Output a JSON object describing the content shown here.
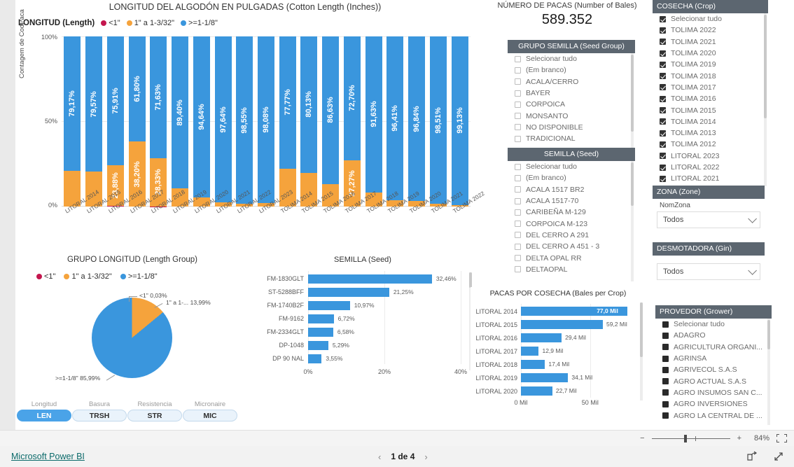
{
  "stacked_chart": {
    "title": "LONGITUD DEL ALGODÓN EN PULGADAS (Cotton Length (Inches))",
    "legend_title": "LONGITUD (Length)",
    "y_axis_label": "Contagem de CodPaca",
    "y_ticks": [
      "100%",
      "50%",
      "0%"
    ],
    "legend": [
      {
        "label": "<1\"",
        "color": "#c4164e"
      },
      {
        "label": "1\" a 1-3/32\"",
        "color": "#f5a33c"
      },
      {
        "label": ">=1-1/8\"",
        "color": "#3a96dd"
      }
    ]
  },
  "chart_data": [
    {
      "type": "bar",
      "title": "LONGITUD DEL ALGODÓN EN PULGADAS (Cotton Length (Inches))",
      "subtype": "stacked-100",
      "xlabel": "",
      "ylabel": "Contagem de CodPaca",
      "ylim": [
        0,
        100
      ],
      "categories": [
        "LITORAL 2014",
        "LITORAL 2015",
        "LITORAL 2016",
        "LITORAL 2017",
        "LITORAL 2018",
        "LITORAL 2019",
        "LITORAL 2020",
        "LITORAL 2021",
        "LITORAL 2022",
        "LITORAL 2023",
        "TOLIMA 2014",
        "TOLIMA 2015",
        "TOLIMA 2016",
        "TOLIMA 2017",
        "TOLIMA 2018",
        "TOLIMA 2019",
        "TOLIMA 2020",
        "TOLIMA 2021",
        "TOLIMA 2022"
      ],
      "series": [
        {
          "name": ">=1-1/8\"",
          "color": "#3a96dd",
          "values": [
            79.17,
            79.57,
            75.91,
            61.8,
            71.63,
            89.4,
            94.64,
            97.64,
            98.55,
            98.08,
            77.77,
            80.13,
            86.63,
            72.7,
            91.63,
            96.41,
            96.84,
            98.51,
            99.13
          ],
          "labels": [
            "79,17%",
            "79,57%",
            "75,91%",
            "61,80%",
            "71,63%",
            "89,40%",
            "94,64%",
            "97,64%",
            "98,55%",
            "98,08%",
            "77,77%",
            "80,13%",
            "86,63%",
            "72,70%",
            "91,63%",
            "96,41%",
            "96,84%",
            "98,51%",
            "99,13%"
          ]
        },
        {
          "name": "1\" a 1-3/32\"",
          "color": "#f5a33c",
          "values": [
            20.8,
            20.4,
            23.88,
            38.2,
            28.33,
            10.57,
            5.33,
            2.34,
            1.43,
            1.9,
            22.2,
            19.84,
            13.34,
            27.27,
            8.34,
            3.56,
            3.13,
            1.46,
            0.85
          ],
          "labels": [
            "",
            "",
            "23,88%",
            "38,20%",
            "28,33%",
            "",
            "",
            "",
            "",
            "",
            "",
            "",
            "",
            "27,27%",
            "",
            "",
            "",
            "",
            ""
          ]
        },
        {
          "name": "<1\"",
          "color": "#c4164e",
          "values": [
            0.03,
            0.03,
            0.21,
            0.0,
            0.04,
            0.03,
            0.03,
            0.02,
            0.02,
            0.02,
            0.03,
            0.03,
            0.03,
            0.03,
            0.03,
            0.03,
            0.03,
            0.03,
            0.02
          ],
          "labels": [
            "",
            "",
            "",
            "",
            "",
            "",
            "",
            "",
            "",
            "",
            "",
            "",
            "",
            "",
            "",
            "",
            "",
            "",
            ""
          ]
        }
      ],
      "legend_position": "top"
    },
    {
      "type": "pie",
      "title": "GRUPO LONGITUD (Length Group)",
      "labels": [
        "<1\"",
        "1\" a 1-...",
        ">=1-1/8\""
      ],
      "values": [
        0.03,
        13.99,
        85.99
      ],
      "value_labels": [
        "<1\" 0,03%",
        "1\" a 1-... 13,99%",
        ">=1-1/8\" 85,99%"
      ],
      "colors": [
        "#c4164e",
        "#f5a33c",
        "#3a96dd"
      ],
      "legend": [
        "<1\"",
        "1\" a 1-3/32\"",
        ">=1-1/8\""
      ],
      "legend_position": "top"
    },
    {
      "type": "bar",
      "subtype": "horizontal",
      "title": "SEMILLA (Seed)",
      "categories": [
        "FM-1830GLT",
        "ST-5288BFF",
        "FM-1740B2F",
        "FM-9162",
        "FM-2334GLT",
        "DP-1048",
        "DP 90 NAL"
      ],
      "values": [
        32.46,
        21.25,
        10.97,
        6.72,
        6.58,
        5.29,
        3.55
      ],
      "value_labels": [
        "32,46%",
        "21,25%",
        "10,97%",
        "6,72%",
        "6,58%",
        "5,29%",
        "3,55%"
      ],
      "x_ticks": [
        "0%",
        "20%",
        "40%"
      ],
      "xlim": [
        0,
        40
      ],
      "color": "#3a96dd"
    },
    {
      "type": "bar",
      "subtype": "horizontal",
      "title": "PACAS POR COSECHA (Bales per Crop)",
      "categories": [
        "LITORAL 2014",
        "LITORAL 2015",
        "LITORAL 2016",
        "LITORAL 2017",
        "LITORAL 2018",
        "LITORAL 2019",
        "LITORAL 2020"
      ],
      "values": [
        77.0,
        59.2,
        29.4,
        12.9,
        17.4,
        34.1,
        22.7
      ],
      "value_labels": [
        "77,0 Mil",
        "59,2 Mil",
        "29,4 Mil",
        "12,9 Mil",
        "17,4 Mil",
        "34,1 Mil",
        "22,7 Mil"
      ],
      "x_ticks": [
        "0 Mil",
        "50 Mil"
      ],
      "xlim": [
        0,
        85
      ],
      "color": "#3a96dd"
    }
  ],
  "kpi": {
    "title": "NÚMERO DE PACAS (Number of Bales)",
    "value": "589.352"
  },
  "slicer_seed_group": {
    "header": "GRUPO SEMILLA (Seed Group)",
    "items": [
      {
        "label": "Selecionar tudo",
        "checked": false
      },
      {
        "label": "(Em branco)",
        "checked": false
      },
      {
        "label": "ACALA/CERRO",
        "checked": false
      },
      {
        "label": "BAYER",
        "checked": false
      },
      {
        "label": "CORPOICA",
        "checked": false
      },
      {
        "label": "MONSANTO",
        "checked": false
      },
      {
        "label": "NO DISPONIBLE",
        "checked": false
      },
      {
        "label": "TRADICIONAL",
        "checked": false
      }
    ]
  },
  "slicer_seed": {
    "header": "SEMILLA (Seed)",
    "items": [
      {
        "label": "Selecionar tudo",
        "checked": false
      },
      {
        "label": "(Em branco)",
        "checked": false
      },
      {
        "label": "ACALA 1517 BR2",
        "checked": false
      },
      {
        "label": "ACALA 1517-70",
        "checked": false
      },
      {
        "label": "CARIBEÑA M-129",
        "checked": false
      },
      {
        "label": "CORPOICA M-123",
        "checked": false
      },
      {
        "label": "DEL CERRO A 291",
        "checked": false
      },
      {
        "label": "DEL CERRO A 451 - 3",
        "checked": false
      },
      {
        "label": "DELTA OPAL RR",
        "checked": false
      },
      {
        "label": "DELTAOPAL",
        "checked": false
      }
    ]
  },
  "slicer_crop": {
    "header": "COSECHA (Crop)",
    "items": [
      {
        "label": "Selecionar tudo",
        "checked": true
      },
      {
        "label": "TOLIMA 2022",
        "checked": true
      },
      {
        "label": "TOLIMA 2021",
        "checked": true
      },
      {
        "label": "TOLIMA 2020",
        "checked": true
      },
      {
        "label": "TOLIMA 2019",
        "checked": true
      },
      {
        "label": "TOLIMA 2018",
        "checked": true
      },
      {
        "label": "TOLIMA 2017",
        "checked": true
      },
      {
        "label": "TOLIMA 2016",
        "checked": true
      },
      {
        "label": "TOLIMA 2015",
        "checked": true
      },
      {
        "label": "TOLIMA 2014",
        "checked": true
      },
      {
        "label": "TOLIMA 2013",
        "checked": true
      },
      {
        "label": "TOLIMA 2012",
        "checked": true
      },
      {
        "label": "LITORAL 2023",
        "checked": true
      },
      {
        "label": "LITORAL 2022",
        "checked": true
      },
      {
        "label": "LITORAL 2021",
        "checked": true
      }
    ]
  },
  "slicer_zone": {
    "header": "ZONA (Zone)",
    "field_label": "NomZona",
    "selected": "Todos"
  },
  "slicer_gin": {
    "header": "DESMOTADORA (Gin)",
    "selected": "Todos"
  },
  "slicer_grower": {
    "header": "PROVEDOR (Grower)",
    "items": [
      {
        "label": "Selecionar tudo",
        "checked": true
      },
      {
        "label": "ADAGRO",
        "checked": true
      },
      {
        "label": "AGRICULTURA ORGANI...",
        "checked": true
      },
      {
        "label": "AGRINSA",
        "checked": true
      },
      {
        "label": "AGRIVECOL S.A.S",
        "checked": true
      },
      {
        "label": "AGRO ACTUAL S.A.S",
        "checked": true
      },
      {
        "label": "AGRO INSUMOS SAN C...",
        "checked": true
      },
      {
        "label": "AGRO INVERSIONES",
        "checked": true
      },
      {
        "label": "AGRO LA CENTRAL DE ...",
        "checked": true
      }
    ]
  },
  "metric_tabs": [
    {
      "caption": "Longitud",
      "label": "LEN",
      "active": true
    },
    {
      "caption": "Basura",
      "label": "TRSH",
      "active": false
    },
    {
      "caption": "Resistencia",
      "label": "STR",
      "active": false
    },
    {
      "caption": "Micronaire",
      "label": "MIC",
      "active": false
    }
  ],
  "zoom_bar": {
    "minus": "−",
    "plus": "+",
    "percent": "84%"
  },
  "footer": {
    "brand": "Microsoft Power BI",
    "page_indicator": "1 de 4",
    "prev": "‹",
    "next": "›"
  }
}
